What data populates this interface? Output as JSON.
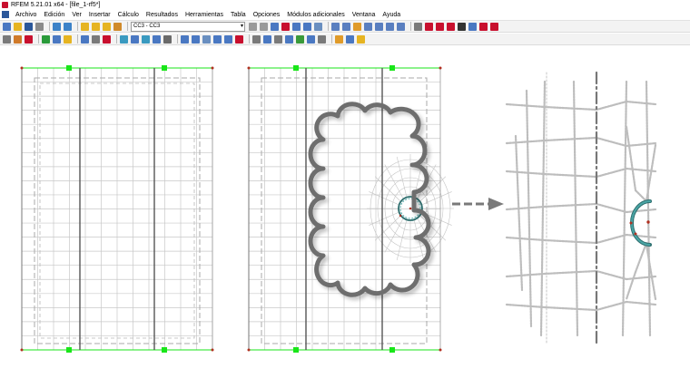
{
  "window": {
    "title": "RFEM 5.21.01 x64 - [file_1-rf5*]"
  },
  "menu": {
    "items": [
      "Archivo",
      "Edición",
      "Ver",
      "Insertar",
      "Cálculo",
      "Resultados",
      "Herramientas",
      "Tabla",
      "Opciones",
      "Módulos adicionales",
      "Ventana",
      "Ayuda"
    ]
  },
  "toolbar": {
    "load_case_select": "CC3 - CC3"
  },
  "colors": {
    "support": "#19e619",
    "mesh": "#c4c4c4",
    "member": "#555555",
    "cloud": "#707070",
    "opening": "#4aa6a6",
    "arrow": "#7a7a7a"
  },
  "icons": [
    "undo-icon",
    "redo-icon",
    "print-icon",
    "save-icon",
    "arrow-right-icon",
    "warning-icon",
    "delete-icon"
  ]
}
